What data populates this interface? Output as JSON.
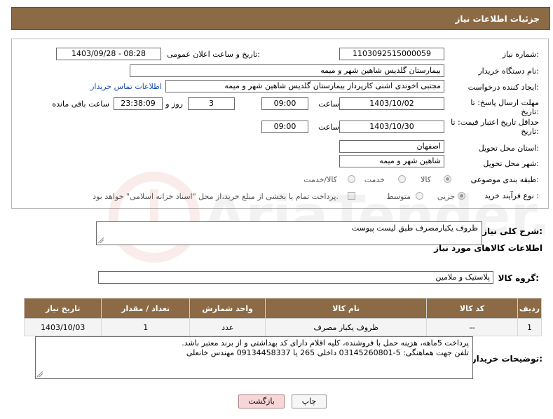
{
  "header": {
    "title": "جزئیات اطلاعات نیاز"
  },
  "fields": {
    "need_number_label": "شماره نیاز:",
    "need_number": "1103092515000059",
    "announce_label": "تاریخ و ساعت اعلان عمومی:",
    "announce_value": "1403/09/28 - 08:28",
    "buyer_org_label": "نام دستگاه خریدار:",
    "buyer_org": "بیمارستان گلدیس  شاهین شهر و میمه",
    "requester_label": "ایجاد کننده درخواست:",
    "requester": "مجتبی اخوندی اشنی کارپرداز بیمارستان گلدیس  شاهین شهر و میمه",
    "contact_link": "اطلاعات تماس خریدار",
    "deadline_label": "مهلت ارسال پاسخ: تا",
    "deadline_label2": "تاریخ:",
    "deadline_date": "1403/10/02",
    "time_label": "ساعت",
    "deadline_time": "09:00",
    "days_value": "3",
    "days_label": "روز و",
    "remaining_time": "23:38:09",
    "remaining_label": "ساعت باقی مانده",
    "validity_label": "حداقل تاریخ اعتبار قیمت: تا",
    "validity_label2": "تاریخ:",
    "validity_date": "1403/10/30",
    "validity_time": "09:00",
    "province_label": "استان محل تحویل:",
    "province": "اصفهان",
    "city_label": "شهر محل تحویل:",
    "city": "شاهین شهر و میمه",
    "category_label": "طبقه بندی موضوعی:",
    "category_options": [
      "کالا",
      "خدمت",
      "کالا/خدمت"
    ],
    "purchase_type_label": "نوع فرآیند خرید :",
    "purchase_options": [
      "جزیی",
      "متوسط"
    ],
    "payment_note": "پرداخت تمام یا بخشی از مبلغ خرید،از محل \"اسناد خزانه اسلامی\" خواهد بود."
  },
  "description": {
    "label": "شرح کلی نیاز:",
    "value": "ظروف یکبارمصرف طبق لیست پیوست"
  },
  "goods_info_title": "اطلاعات کالاهای مورد نیاز",
  "goods_group": {
    "label": "گروه کالا:",
    "value": "پلاستیک و ملامین"
  },
  "table": {
    "headers": [
      "ردیف",
      "کد کالا",
      "نام کالا",
      "واحد شمارش",
      "تعداد / مقدار",
      "تاریخ نیاز"
    ],
    "rows": [
      [
        "1",
        "--",
        "ظروف یکبار مصرف",
        "عدد",
        "1",
        "1403/10/03"
      ]
    ]
  },
  "buyer_notes": {
    "label": "توضیحات خریدار:",
    "line1": "پرداخت 5ماهه، هزینه حمل با فروشنده، کلیه اقلام دارای کد بهداشتی و از برند معتبر باشد.",
    "line2": "تلفن جهت هماهنگی: 5-03145260801 داخلی 265 یا 09134458337 مهندس خانعلی"
  },
  "buttons": {
    "print": "چاپ",
    "back": "بازگشت"
  },
  "watermark": "AriaTender.net"
}
